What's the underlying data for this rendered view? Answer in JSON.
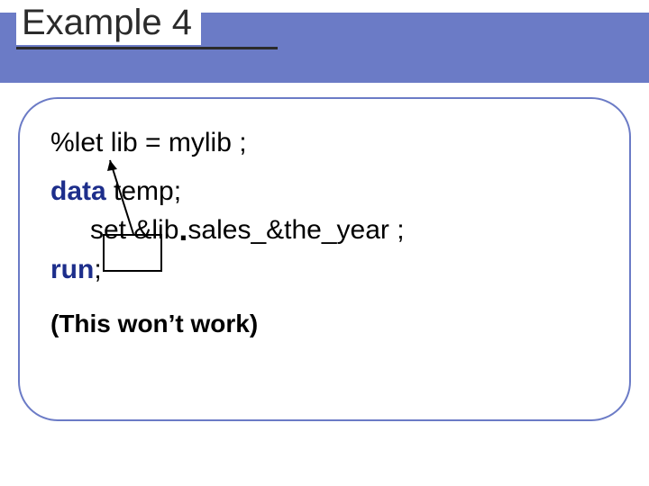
{
  "title": "Example 4",
  "code": {
    "line1": "%let lib = mylib ;",
    "line2_kw": "data",
    "line2_rest": " temp;",
    "line3_set": "set ",
    "line3_lib": "&lib",
    "line3_dot": ".",
    "line3_rest": "sales_&the_year ;",
    "line4_kw": "run",
    "line4_rest": ";"
  },
  "note": "(This won’t work)"
}
